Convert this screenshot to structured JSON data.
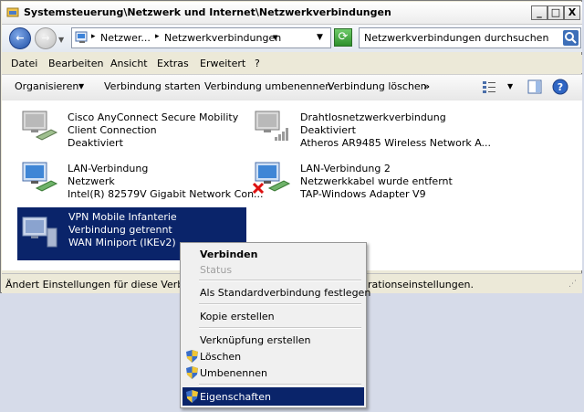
{
  "window": {
    "title": "Systemsteuerung\\Netzwerk und Internet\\Netzwerkverbindungen",
    "minimize_glyph": "_",
    "maximize_glyph": "□",
    "close_glyph": "X"
  },
  "nav": {
    "back_glyph": "←",
    "forward_glyph": "→",
    "breadcrumb_1": "Netzwer...",
    "breadcrumb_2": "Netzwerkverbindungen",
    "search_placeholder": "Netzwerkverbindungen durchsuchen"
  },
  "menu": {
    "items": [
      "Datei",
      "Bearbeiten",
      "Ansicht",
      "Extras",
      "Erweitert",
      "?"
    ]
  },
  "toolbar": {
    "organize": "Organisieren",
    "start": "Verbindung starten",
    "rename": "Verbindung umbenennen",
    "delete": "Verbindung löschen",
    "more": "»"
  },
  "connections": [
    {
      "name": "Cisco AnyConnect Secure Mobility",
      "line2": "Client Connection",
      "line3": "Deaktiviert"
    },
    {
      "name": "Drahtlosnetzwerkverbindung",
      "line2": "Deaktiviert",
      "line3": "Atheros AR9485 Wireless Network A..."
    },
    {
      "name": "LAN-Verbindung",
      "line2": "Netzwerk",
      "line3": "Intel(R) 82579V Gigabit Network Con..."
    },
    {
      "name": "LAN-Verbindung 2",
      "line2": "Netzwerkkabel wurde entfernt",
      "line3": "TAP-Windows Adapter V9"
    },
    {
      "name": "VPN Mobile Infanterie",
      "line2": "Verbindung getrennt",
      "line3": "WAN Miniport (IKEv2)"
    }
  ],
  "status": {
    "left": "Ändert Einstellungen für diese Verbindu",
    "right": "rationseinstellungen."
  },
  "context_menu": {
    "connect": "Verbinden",
    "status": "Status",
    "set_default": "Als Standardverbindung festlegen",
    "copy": "Kopie erstellen",
    "shortcut": "Verknüpfung erstellen",
    "delete": "Löschen",
    "rename": "Umbenennen",
    "properties": "Eigenschaften"
  },
  "colors": {
    "selection": "#0a246a",
    "accent": "#3a6ea5"
  }
}
